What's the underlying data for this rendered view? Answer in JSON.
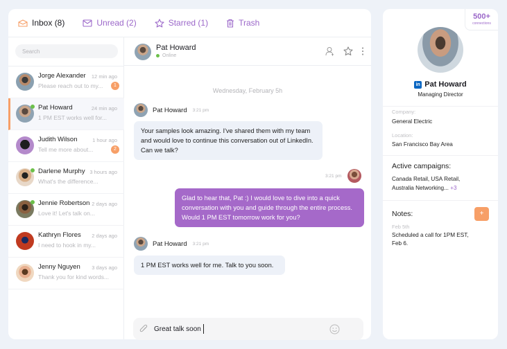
{
  "tabs": [
    {
      "label": "Inbox (8)",
      "icon": "inbox-icon",
      "active": true
    },
    {
      "label": "Unread (2)",
      "icon": "mail-icon",
      "active": false
    },
    {
      "label": "Starred (1)",
      "icon": "star-icon",
      "active": false
    },
    {
      "label": "Trash",
      "icon": "trash-icon",
      "active": false
    }
  ],
  "search": {
    "placeholder": "Search",
    "value": ""
  },
  "conversations": [
    {
      "name": "Jorge Alexander",
      "time": "12 min ago",
      "snippet": "Please reach out to my...",
      "unread": "1",
      "online": false,
      "active": false
    },
    {
      "name": "Pat Howard",
      "time": "24 min ago",
      "snippet": "1 PM EST works well for...",
      "unread": null,
      "online": true,
      "active": true
    },
    {
      "name": "Judith Wilson",
      "time": "1 hour ago",
      "snippet": "Tell me more about...",
      "unread": "2",
      "online": false,
      "active": false
    },
    {
      "name": "Darlene Murphy",
      "time": "3 hours ago",
      "snippet": "What's the difference...",
      "unread": null,
      "online": true,
      "active": false
    },
    {
      "name": "Jennie Robertson",
      "time": "2 days ago",
      "snippet": "Love it! Let's talk on...",
      "unread": null,
      "online": true,
      "active": false
    },
    {
      "name": "Kathryn Flores",
      "time": "2 days ago",
      "snippet": "I need to hook in my...",
      "unread": null,
      "online": false,
      "active": false
    },
    {
      "name": "Jenny Nguyen",
      "time": "3 days ago",
      "snippet": "Thank you for kind words...",
      "unread": null,
      "online": false,
      "active": false
    }
  ],
  "chat": {
    "contact_name": "Pat Howard",
    "status": "Online",
    "date_divider": "Wednesday, February 5h",
    "messages": [
      {
        "sender": "Pat Howard",
        "time": "3:21 pm",
        "direction": "in",
        "text": "Your samples look amazing. I've shared them with my team and would love to continue this conversation out of LinkedIn. Can we talk?"
      },
      {
        "sender": "me",
        "time": "3:21 pm",
        "direction": "out",
        "text": "Glad to hear that, Pat :) I would love to dive into a quick conversation with you and guide through the entire process. Would 1 PM EST tomorrow work for you?"
      },
      {
        "sender": "Pat Howard",
        "time": "3:21 pm",
        "direction": "in",
        "text": "1 PM EST works well for me. Talk to you soon."
      }
    ],
    "composer_value": "Great talk soon"
  },
  "profile": {
    "connections_count": "500+",
    "connections_label": "connections",
    "network_badge": "in",
    "name": "Pat Howard",
    "title": "Managing Director",
    "company_label": "Company:",
    "company": "General Electric",
    "location_label": "Location:",
    "location": "San Francisco Bay Area",
    "campaigns_heading": "Active campaigns:",
    "campaigns_line1": "Canada Retail, USA Retail,",
    "campaigns_line2": "Australia Networking...",
    "campaigns_more": "+3",
    "notes_heading": "Notes:",
    "add_note_label": "+",
    "note_date": "Feb 5th",
    "note_text_line1": "Scheduled a call for 1PM EST,",
    "note_text_line2": "Feb 6."
  },
  "colors": {
    "accent_purple": "#9b67c9",
    "accent_orange": "#f79f67",
    "online_green": "#6cc04a",
    "outgoing_bubble": "#a569c9",
    "incoming_bubble": "#edf1f8"
  }
}
